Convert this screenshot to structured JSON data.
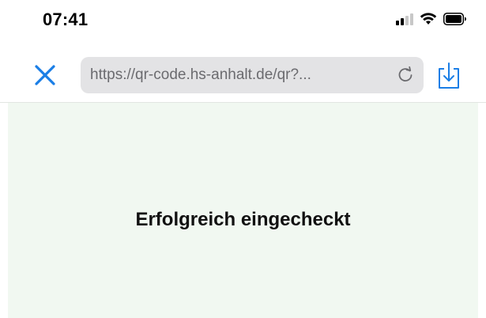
{
  "status_bar": {
    "time": "07:41",
    "icons": [
      "signal-icon",
      "wifi-icon",
      "battery-icon"
    ]
  },
  "browser": {
    "close_icon": "close-icon",
    "url": "https://qr-code.hs-anhalt.de/qr?...",
    "reload_icon": "reload-icon",
    "share_icon": "share-icon",
    "accent_color": "#1a7ee6"
  },
  "content": {
    "message": "Erfolgreich eingecheckt",
    "background_color": "#f1f8f1"
  }
}
